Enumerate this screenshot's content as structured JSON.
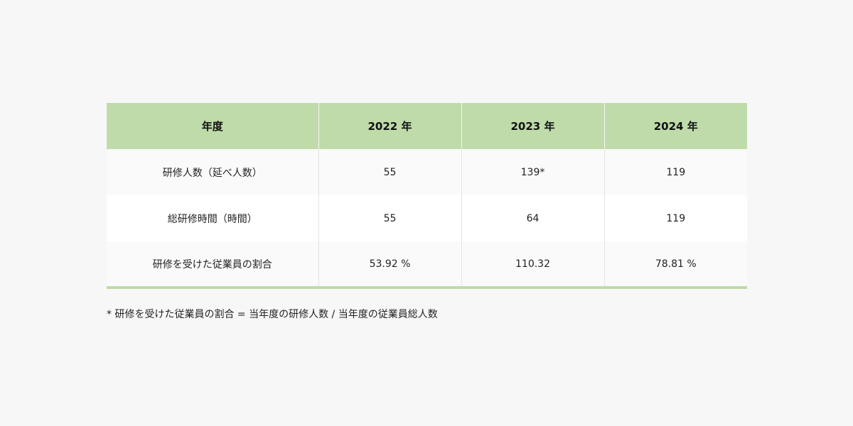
{
  "table": {
    "headers": [
      "年度",
      "2022 年",
      "2023 年",
      "2024 年"
    ],
    "rows": [
      [
        "研修人数（延べ人数）",
        "55",
        "139*",
        "119"
      ],
      [
        "総研修時間（時間）",
        "55",
        "64",
        "119"
      ],
      [
        "研修を受けた従業員の割合",
        "53.92 %",
        "110.32",
        "78.81 %"
      ]
    ]
  },
  "footnote": "* 研修を受けた従業員の割合 = 当年度の研修人数 / 当年度の従業員総人数",
  "colors": {
    "header_bg": "#bedba9",
    "page_bg": "#f7f7f7"
  }
}
